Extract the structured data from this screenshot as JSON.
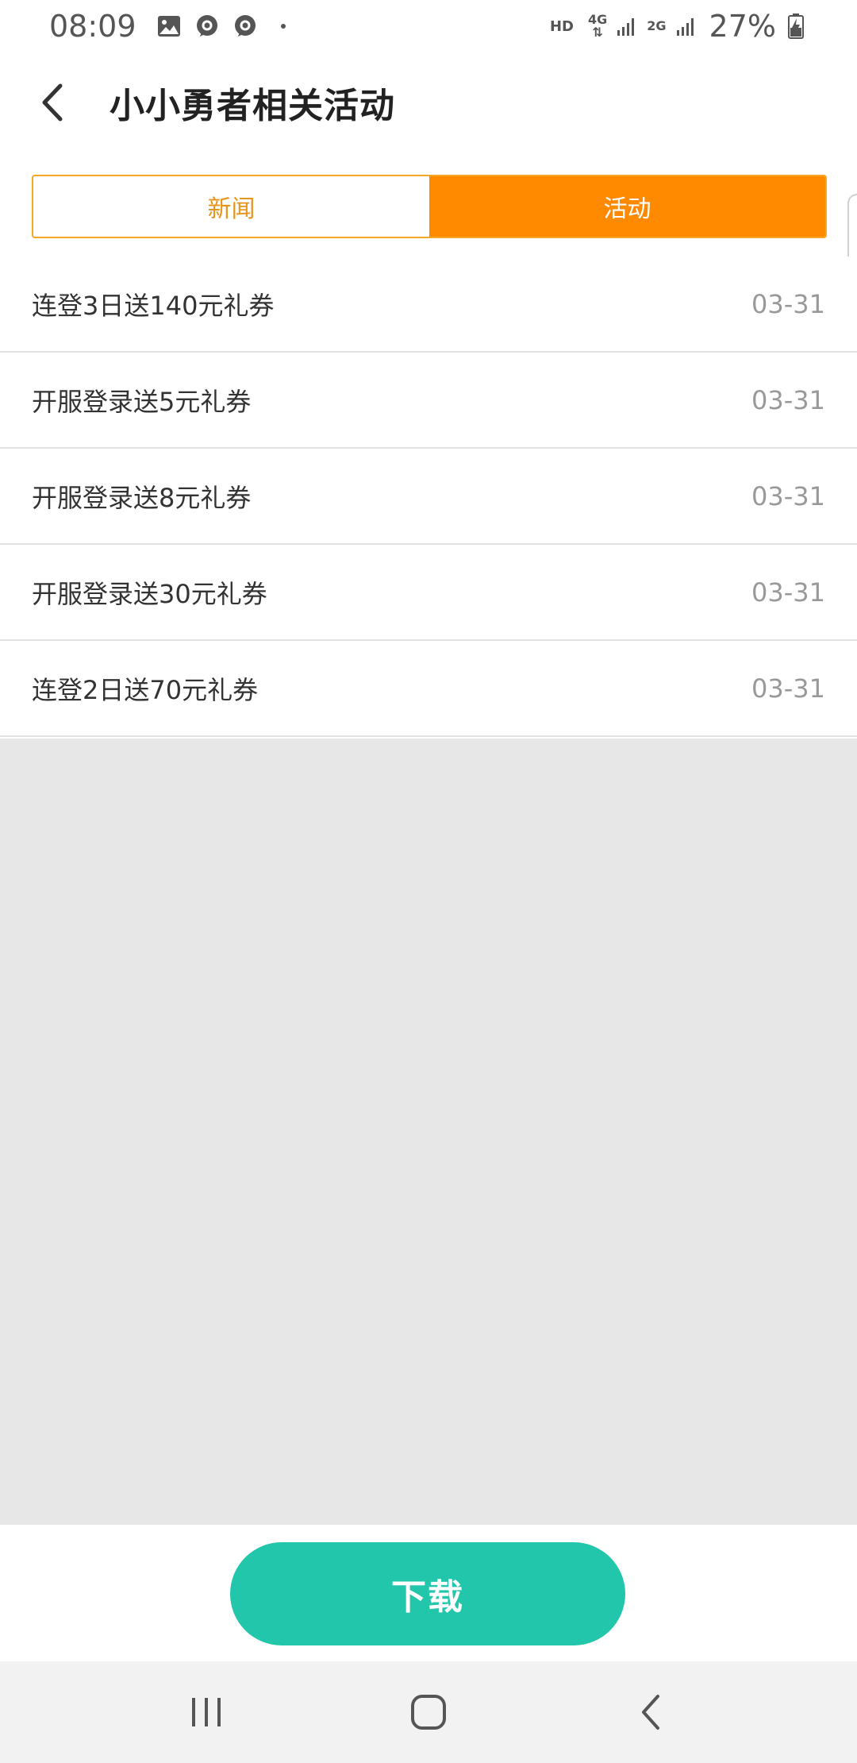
{
  "status_bar": {
    "time": "08:09",
    "hd": "HD",
    "net_4g": "4G",
    "net_2g": "2G",
    "battery": "27%",
    "icons": [
      "image-icon",
      "chat-bubble-icon",
      "chat-bubble-icon",
      "dot-icon",
      "signal-icon",
      "battery-charging-icon"
    ]
  },
  "header": {
    "title": "小小勇者相关活动",
    "back_icon": "chevron-left-icon"
  },
  "tabs": [
    {
      "label": "新闻",
      "active": false
    },
    {
      "label": "活动",
      "active": true
    }
  ],
  "list": {
    "items": [
      {
        "title": "连登3日送140元礼券",
        "date": "03-31"
      },
      {
        "title": "开服登录送5元礼券",
        "date": "03-31"
      },
      {
        "title": "开服登录送8元礼券",
        "date": "03-31"
      },
      {
        "title": "开服登录送30元礼券",
        "date": "03-31"
      },
      {
        "title": "连登2日送70元礼券",
        "date": "03-31"
      }
    ]
  },
  "download": {
    "label": "下载"
  },
  "nav_bar": {
    "icons": [
      "recent-apps-icon",
      "home-icon",
      "back-icon"
    ]
  },
  "colors": {
    "accent_orange": "#ff8a00",
    "tab_border": "#f5a623",
    "download_green": "#22c7ab",
    "background_gray": "#e7e7e7"
  }
}
